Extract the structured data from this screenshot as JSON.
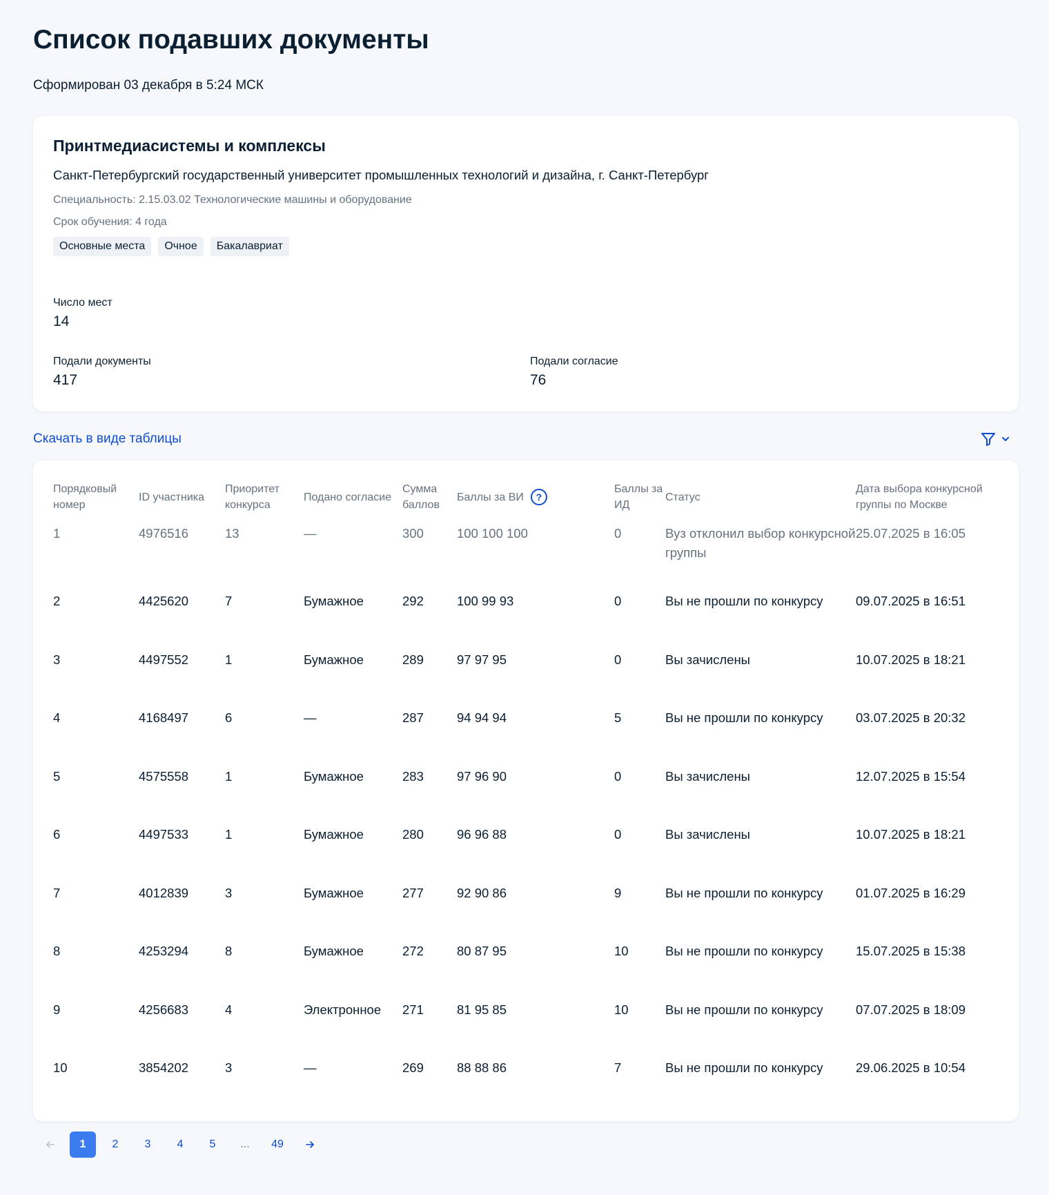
{
  "page": {
    "title": "Список подавших документы",
    "generated": "Сформирован 03 декабря в 5:24 МСК"
  },
  "program": {
    "title": "Принтмедиасистемы и комплексы",
    "university": "Санкт-Петербургский государственный университет промышленных технологий и дизайна, г. Санкт-Петербург",
    "speciality": "Специальность: 2.15.03.02 Технологические машины и оборудование",
    "term": "Срок обучения: 4 года",
    "tags": [
      "Основные места",
      "Очное",
      "Бакалавриат"
    ]
  },
  "stats": {
    "places_label": "Число мест",
    "places_value": "14",
    "docs_label": "Подали документы",
    "docs_value": "417",
    "consent_label": "Подали согласие",
    "consent_value": "76"
  },
  "toolbar": {
    "download_label": "Скачать в виде таблицы",
    "filter_icon": "filter-icon",
    "chevron_icon": "chevron-down-icon"
  },
  "table": {
    "headers": {
      "num": "Порядковый номер",
      "id": "ID участника",
      "priority": "Приоритет конкурса",
      "consent": "Подано согласие",
      "sum": "Сумма баллов",
      "vi": "Баллы за ВИ",
      "id_points": "Баллы за ИД",
      "status": "Статус",
      "date": "Дата выбора конкурсной группы по Москве"
    },
    "rows": [
      {
        "num": "1",
        "id": "4976516",
        "priority": "13",
        "consent": "—",
        "sum": "300",
        "vi": "100 100 100",
        "id_points": "0",
        "status": "Вуз отклонил выбор конкурсной группы",
        "date": "25.07.2025 в 16:05"
      },
      {
        "num": "2",
        "id": "4425620",
        "priority": "7",
        "consent": "Бумажное",
        "sum": "292",
        "vi": "100 99 93",
        "id_points": "0",
        "status": "Вы не прошли по конкурсу",
        "date": "09.07.2025 в 16:51"
      },
      {
        "num": "3",
        "id": "4497552",
        "priority": "1",
        "consent": "Бумажное",
        "sum": "289",
        "vi": "97 97 95",
        "id_points": "0",
        "status": "Вы зачислены",
        "date": "10.07.2025 в 18:21"
      },
      {
        "num": "4",
        "id": "4168497",
        "priority": "6",
        "consent": "—",
        "sum": "287",
        "vi": "94 94 94",
        "id_points": "5",
        "status": "Вы не прошли по конкурсу",
        "date": "03.07.2025 в 20:32"
      },
      {
        "num": "5",
        "id": "4575558",
        "priority": "1",
        "consent": "Бумажное",
        "sum": "283",
        "vi": "97 96 90",
        "id_points": "0",
        "status": "Вы зачислены",
        "date": "12.07.2025 в 15:54"
      },
      {
        "num": "6",
        "id": "4497533",
        "priority": "1",
        "consent": "Бумажное",
        "sum": "280",
        "vi": "96 96 88",
        "id_points": "0",
        "status": "Вы зачислены",
        "date": "10.07.2025 в 18:21"
      },
      {
        "num": "7",
        "id": "4012839",
        "priority": "3",
        "consent": "Бумажное",
        "sum": "277",
        "vi": "92 90 86",
        "id_points": "9",
        "status": "Вы не прошли по конкурсу",
        "date": "01.07.2025 в 16:29"
      },
      {
        "num": "8",
        "id": "4253294",
        "priority": "8",
        "consent": "Бумажное",
        "sum": "272",
        "vi": "80 87 95",
        "id_points": "10",
        "status": "Вы не прошли по конкурсу",
        "date": "15.07.2025 в 15:38"
      },
      {
        "num": "9",
        "id": "4256683",
        "priority": "4",
        "consent": "Электронное",
        "sum": "271",
        "vi": "81 95 85",
        "id_points": "10",
        "status": "Вы не прошли по конкурсу",
        "date": "07.07.2025 в 18:09"
      },
      {
        "num": "10",
        "id": "3854202",
        "priority": "3",
        "consent": "—",
        "sum": "269",
        "vi": "88 88 86",
        "id_points": "7",
        "status": "Вы не прошли по конкурсу",
        "date": "29.06.2025 в 10:54"
      }
    ]
  },
  "pagination": {
    "pages": [
      "1",
      "2",
      "3",
      "4",
      "5",
      "...",
      "49"
    ],
    "current": "1",
    "prev_icon": "arrow-left-icon",
    "next_icon": "arrow-right-icon"
  },
  "colors": {
    "accent": "#0d4cd3",
    "active_page": "#3a7bf0",
    "muted_text": "#66727f",
    "text": "#0b1f33",
    "background": "#f6f8fb"
  }
}
